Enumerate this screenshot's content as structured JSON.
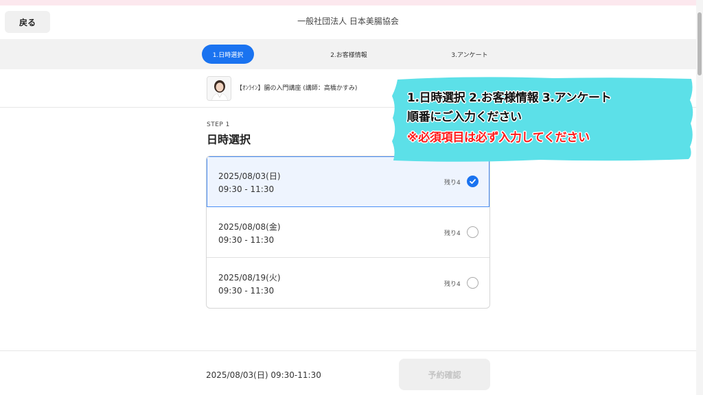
{
  "header": {
    "back_label": "戻る",
    "org_name": "一般社団法人 日本美腸協会"
  },
  "steps": [
    {
      "label": "1.日時選択",
      "active": true
    },
    {
      "label": "2.お客様情報",
      "active": false
    },
    {
      "label": "3.アンケート",
      "active": false
    }
  ],
  "course": {
    "title": "【ｵﾝﾗｲﾝ】腸の入門講座 (講師：高橋かすみ)"
  },
  "step_section": {
    "step_label": "STEP 1",
    "title": "日時選択"
  },
  "slots": [
    {
      "date": "2025/08/03(日)",
      "time": "09:30 - 11:30",
      "remaining": "残り4",
      "selected": true
    },
    {
      "date": "2025/08/08(金)",
      "time": "09:30 - 11:30",
      "remaining": "残り4",
      "selected": false
    },
    {
      "date": "2025/08/19(火)",
      "time": "09:30 - 11:30",
      "remaining": "残り4",
      "selected": false
    }
  ],
  "footer": {
    "summary": "2025/08/03(日) 09:30-11:30",
    "confirm_label": "予約確認"
  },
  "annotation": {
    "line1": "1.日時選択  2.お客様情報  3.アンケート",
    "line2": "順番にご入力ください",
    "line3": "※必須項目は必ず入力してください"
  },
  "colors": {
    "accent": "#1a73f0",
    "callout_bg": "#5ce0e8",
    "warning_text": "#ff1a1a"
  }
}
